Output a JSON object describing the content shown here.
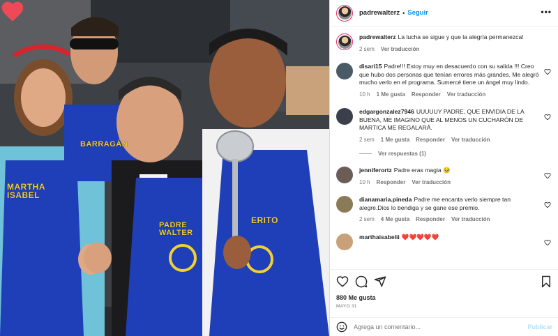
{
  "header": {
    "username": "padrewalterz",
    "separator": "•",
    "follow_label": "Seguir",
    "more_label": "•••"
  },
  "caption": {
    "username": "padrewalterz",
    "text": "La lucha se sigue y que la alegría permanezca!",
    "time": "2 sem",
    "translation_label": "Ver traducción"
  },
  "comments": [
    {
      "username": "disari15",
      "text": "Padre!!! Estoy muy en desacuerdo con su salida !!! Creo que hubo dos personas que tenían errores más grandes. Me alegró mucho verlo en el programa. Sumercé tiene un ángel muy lindo.",
      "time": "10 h",
      "likes": "1 Me gusta",
      "reply_label": "Responder",
      "translation_label": "Ver traducción",
      "avatar_color": "#4a5a66"
    },
    {
      "username": "edgargonzalez7946",
      "text": "UUUUUY PADRE, QUE ENVIDIA DE LA BUENA, ME IMAGINO QUE AL MENOS UN CUCHARÓN DE MARTICA ME REGALARÁ.",
      "time": "2 sem",
      "likes": "1 Me gusta",
      "reply_label": "Responder",
      "translation_label": "Ver traducción",
      "avatar_color": "#3b3f4a",
      "replies_label": "Ver respuestas (1)"
    },
    {
      "username": "jenniferortz",
      "text": "Padre eras magia 🥹",
      "time": "10 h",
      "likes": "",
      "reply_label": "Responder",
      "translation_label": "Ver traducción",
      "avatar_color": "#6b5c57"
    },
    {
      "username": "dianamaria.pineda",
      "text": "Padre me encanta verlo siempre tan alegre.Dios lo bendiga y se gane ese premio.",
      "time": "2 sem",
      "likes": "4 Me gusta",
      "reply_label": "Responder",
      "translation_label": "Ver traducción",
      "avatar_color": "#8a7a55"
    },
    {
      "username": "marthaisabelii",
      "text": "❤️❤️❤️❤️❤️",
      "time": "",
      "likes": "",
      "reply_label": "",
      "translation_label": "",
      "avatar_color": "#c8a17a"
    }
  ],
  "actions": {
    "likes": "880 Me gusta",
    "date": "Mayo 31",
    "icons": [
      "heart-icon",
      "comment-icon",
      "share-icon",
      "bookmark-icon"
    ]
  },
  "add_comment": {
    "placeholder": "Agrega un comentario...",
    "post_label": "Publicar",
    "emoji_icon": "emoji-icon"
  },
  "photo": {
    "apron_labels": [
      "MARTHA ISABEL",
      "BARRAGÁN",
      "PADRE WALTER",
      "ERITO"
    ],
    "overlay_icon": "heart-icon"
  },
  "colors": {
    "accent": "#0095f6",
    "apron": "#1f3fb8",
    "heart": "#ed4956"
  }
}
